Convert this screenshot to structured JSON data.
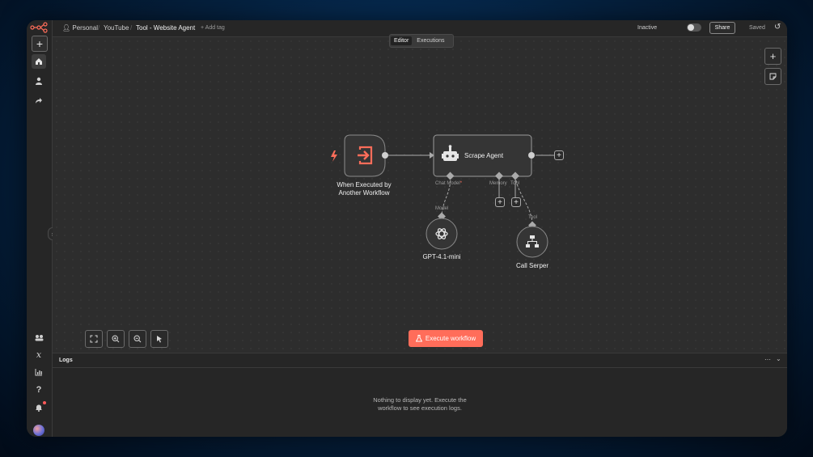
{
  "header": {
    "breadcrumb": [
      "Personal",
      "YouTube"
    ],
    "workflow_title": "Tool - Website Agent",
    "add_tag": "+ Add tag",
    "status_label": "Inactive",
    "share_label": "Share",
    "saved_label": "Saved"
  },
  "tabs": [
    {
      "label": "Editor",
      "active": true
    },
    {
      "label": "Executions",
      "active": false
    }
  ],
  "nodes": {
    "trigger": {
      "label_line1": "When Executed by",
      "label_line2": "Another Workflow",
      "icon": "exit-arrow-icon"
    },
    "agent": {
      "label": "Scrape Agent",
      "icon": "robot-icon",
      "ports": {
        "chat_model": "Chat Model",
        "memory": "Memory",
        "tool": "Tool"
      }
    },
    "model": {
      "label": "GPT-4.1-mini",
      "port": "Model",
      "icon": "openai-icon"
    },
    "tool": {
      "label": "Call Serper",
      "port": "Tool",
      "icon": "network-icon"
    }
  },
  "canvas": {
    "execute_label": "Execute workflow"
  },
  "logs": {
    "title": "Logs",
    "empty_line1": "Nothing to display yet. Execute the",
    "empty_line2": "workflow to see execution logs."
  },
  "colors": {
    "accent": "#ff6d5a",
    "canvas_bg": "#2d2d2d",
    "panel_bg": "#262626"
  }
}
